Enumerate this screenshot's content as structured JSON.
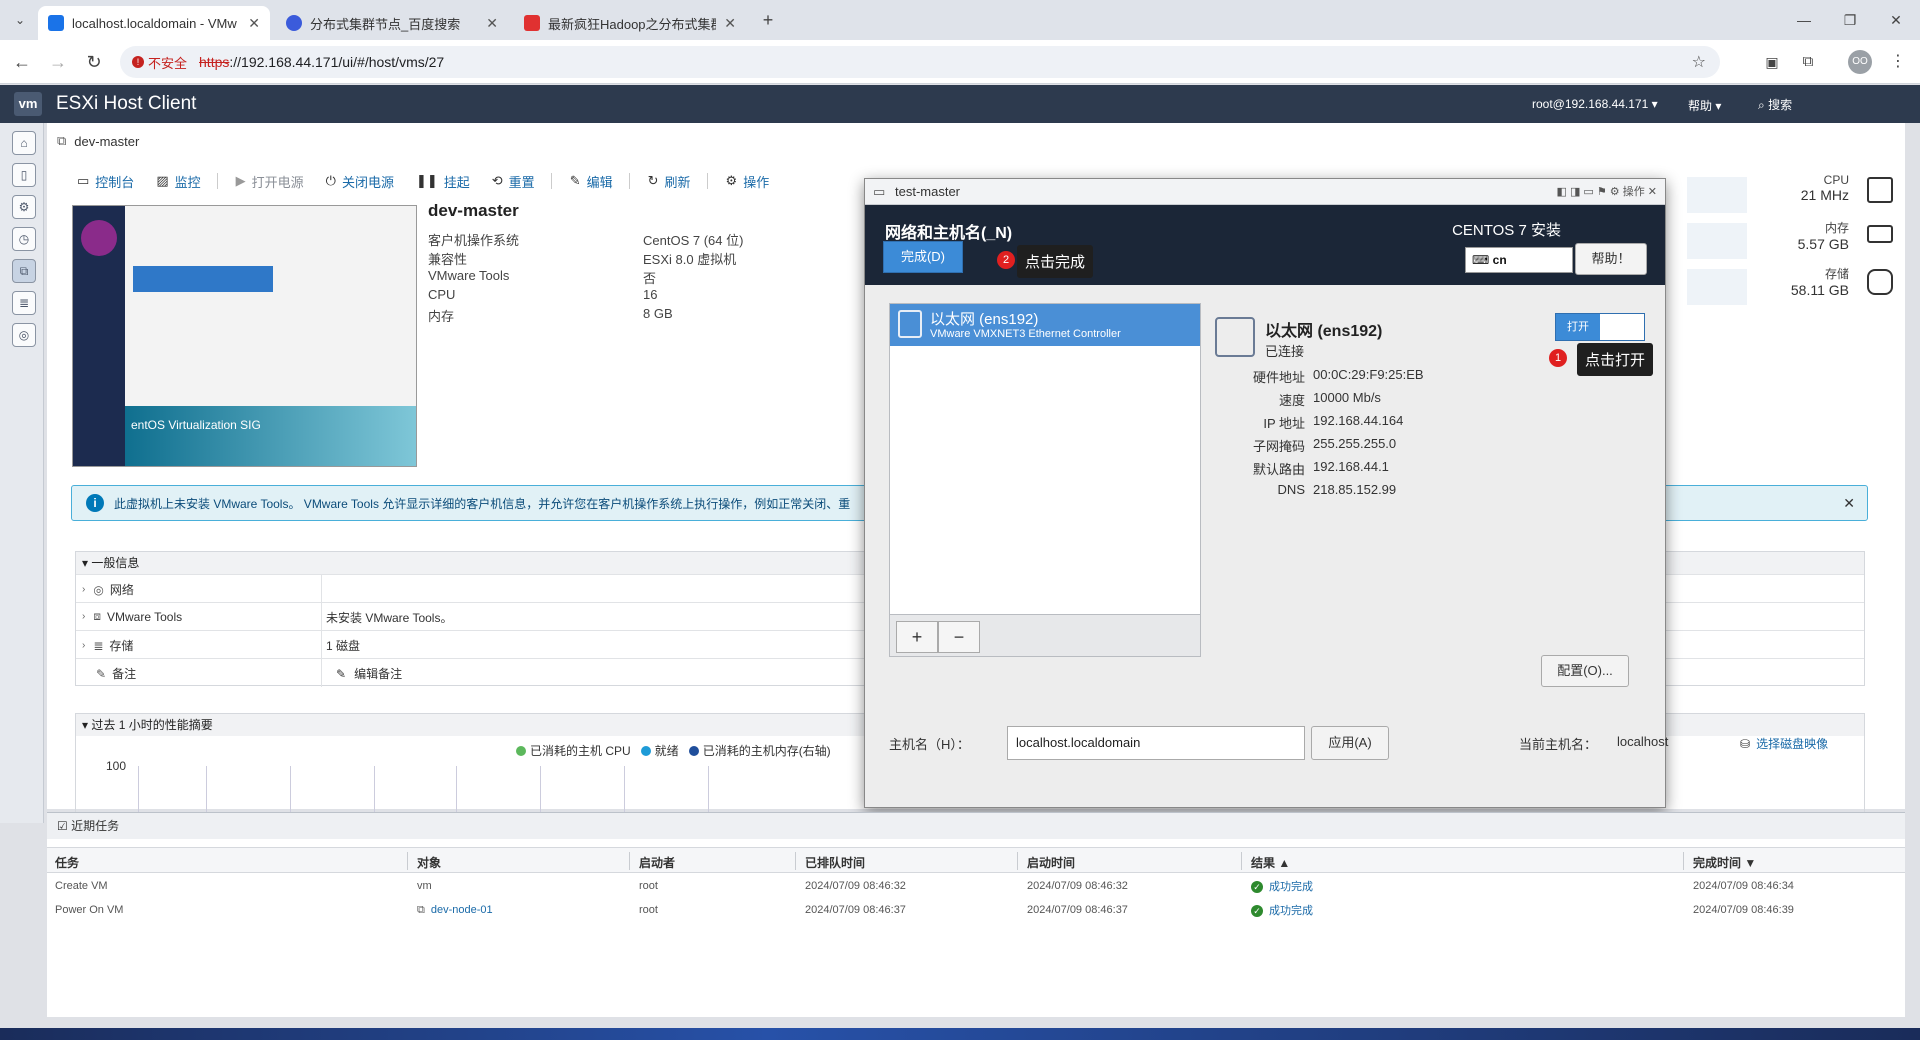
{
  "browser": {
    "tabs": [
      {
        "title": "localhost.localdomain - VMw",
        "active": true,
        "color": "#1a73e8"
      },
      {
        "title": "分布式集群节点_百度搜索",
        "active": false,
        "color": "#3b5bdb"
      },
      {
        "title": "最新疯狂Hadoop之分布式集群",
        "active": false,
        "color": "#e03131"
      }
    ],
    "insecure_label": "不安全",
    "url_scheme": "https",
    "url_rest": "://192.168.44.171/ui/#/host/vms/27",
    "profile_initials": "OO"
  },
  "esxi": {
    "logo": "vm",
    "title": "ESXi Host Client",
    "user": "root@192.168.44.171 ▾",
    "help": "帮助 ▾",
    "search": "搜索"
  },
  "breadcrumb": "dev-master",
  "toolbar": {
    "console": "控制台",
    "monitor": "监控",
    "power_on": "打开电源",
    "power_off": "关闭电源",
    "suspend": "挂起",
    "reset": "重置",
    "edit": "编辑",
    "refresh": "刷新",
    "actions": "操作"
  },
  "vm": {
    "name": "dev-master",
    "props": [
      {
        "k": "客户机操作系统",
        "v": "CentOS 7 (64 位)"
      },
      {
        "k": "兼容性",
        "v": "ESXi 8.0 虚拟机"
      },
      {
        "k": "VMware Tools",
        "v": "否"
      },
      {
        "k": "CPU",
        "v": "16"
      },
      {
        "k": "内存",
        "v": "8 GB"
      }
    ],
    "thumb_caption": "entOS Virtualization SIG"
  },
  "metrics": {
    "cpu_label": "CPU",
    "cpu_value": "21 MHz",
    "mem_label": "内存",
    "mem_value": "5.57 GB",
    "storage_label": "存储",
    "storage_value": "58.11 GB"
  },
  "info": "此虚拟机上未安装 VMware Tools。 VMware Tools 允许显示详细的客户机信息，并允许您在客户机操作系统上执行操作，例如正常关闭、重",
  "general": {
    "title": "一般信息",
    "rows": [
      {
        "k": "网络",
        "v": ""
      },
      {
        "k": "VMware Tools",
        "v": "未安装 VMware Tools。"
      },
      {
        "k": "存储",
        "v": "1 磁盘"
      },
      {
        "k": "备注",
        "v": "编辑备注"
      }
    ]
  },
  "perf": {
    "title": "过去 1 小时的性能摘要",
    "legend": [
      "已消耗的主机 CPU",
      "就绪",
      "已消耗的主机内存(右轴)"
    ],
    "legend_colors": [
      "#5cb85c",
      "#1e9bd7",
      "#1f4e9b"
    ],
    "ymax": "100"
  },
  "select_image": "选择磁盘映像",
  "tasks": {
    "title": "近期任务",
    "headers": [
      "任务",
      "对象",
      "启动者",
      "已排队时间",
      "启动时间",
      "结果 ▲",
      "完成时间 ▼"
    ],
    "rows": [
      {
        "task": "Create VM",
        "object": "vm",
        "initiator": "root",
        "queued": "2024/07/09 08:46:32",
        "started": "2024/07/09 08:46:32",
        "result": "成功完成",
        "completed": "2024/07/09 08:46:34"
      },
      {
        "task": "Power On VM",
        "object": "dev-node-01",
        "initiator": "root",
        "queued": "2024/07/09 08:46:37",
        "started": "2024/07/09 08:46:37",
        "result": "成功完成",
        "completed": "2024/07/09 08:46:39"
      }
    ]
  },
  "console": {
    "title": "test-master",
    "title_icons": "◧ ◨ ▭ ⚑ ⚙ 操作 ✕",
    "heading": "网络和主机名(_N)",
    "done": "完成(D)",
    "installer": "CENTOS 7 安装",
    "keyboard": "cn",
    "help": "帮助！",
    "tip_done": "点击完成",
    "tip_on": "点击打开",
    "badge1": "1",
    "badge2": "2",
    "iface_name": "以太网 (ens192)",
    "iface_desc": "VMware VMXNET3 Ethernet Controller",
    "status": "已连接",
    "toggle": "打开",
    "details": [
      {
        "k": "硬件地址",
        "v": "00:0C:29:F9:25:EB"
      },
      {
        "k": "速度",
        "v": "10000 Mb/s"
      },
      {
        "k": "IP 地址",
        "v": "192.168.44.164"
      },
      {
        "k": "子网掩码",
        "v": "255.255.255.0"
      },
      {
        "k": "默认路由",
        "v": "192.168.44.1"
      },
      {
        "k": "DNS",
        "v": "218.85.152.99"
      }
    ],
    "configure": "配置(O)...",
    "hostname_label": "主机名（H）：",
    "hostname_value": "localhost.localdomain",
    "apply": "应用(A)",
    "current_label": "当前主机名：",
    "current_value": "localhost"
  }
}
